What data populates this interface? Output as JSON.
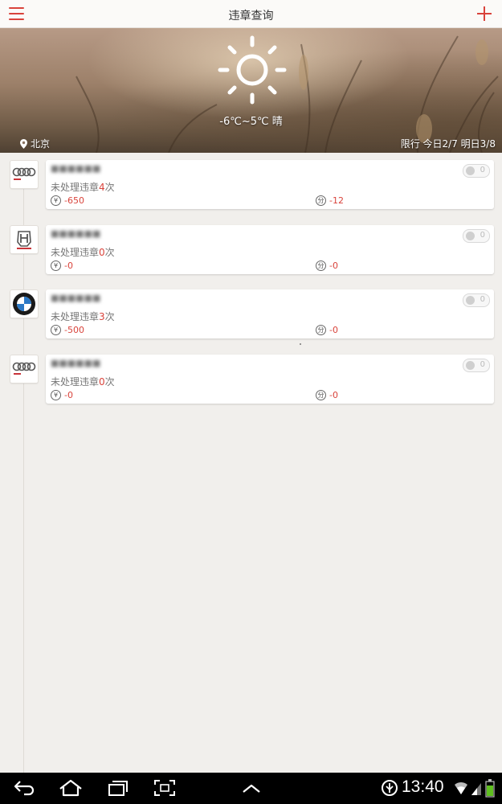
{
  "header": {
    "title": "违章查询"
  },
  "banner": {
    "weather": "-6℃~5℃ 晴",
    "city": "北京",
    "restriction": "限行  今日2/7  明日3/8"
  },
  "vehicles": [
    {
      "brand": "Audi",
      "plate": "■■■■■■",
      "status_prefix": "未处理违章",
      "count": "4",
      "status_suffix": "次",
      "fine": "-650",
      "points": "-12",
      "toggle_count": "0"
    },
    {
      "brand": "HONDA",
      "plate": "■■■■■■",
      "status_prefix": "未处理违章",
      "count": "0",
      "status_suffix": "次",
      "fine": "-0",
      "points": "-0",
      "toggle_count": "0"
    },
    {
      "brand": "BMW",
      "plate": "■■■■■■",
      "status_prefix": "未处理违章",
      "count": "3",
      "status_suffix": "次",
      "fine": "-500",
      "points": "-0",
      "toggle_count": "0"
    },
    {
      "brand": "Audi",
      "plate": "■■■■■■",
      "status_prefix": "未处理违章",
      "count": "0",
      "status_suffix": "次",
      "fine": "-0",
      "points": "-0",
      "toggle_count": "0"
    }
  ],
  "labels": {
    "yuan": "¥",
    "fen": "分"
  },
  "statusbar": {
    "time": "13:40"
  },
  "icons": {
    "menu": "hamburger-menu-icon",
    "add": "plus-icon",
    "weather": "sun-icon",
    "location": "location-pin-icon",
    "back": "back-icon",
    "home": "home-icon",
    "recent": "recent-apps-icon",
    "screenshot": "screenshot-icon",
    "up": "chevron-up-icon",
    "usb": "usb-debug-icon",
    "wifi": "wifi-icon",
    "signal": "signal-icon",
    "battery": "battery-icon"
  },
  "colors": {
    "accent": "#d9433b",
    "background": "#f1efec"
  }
}
